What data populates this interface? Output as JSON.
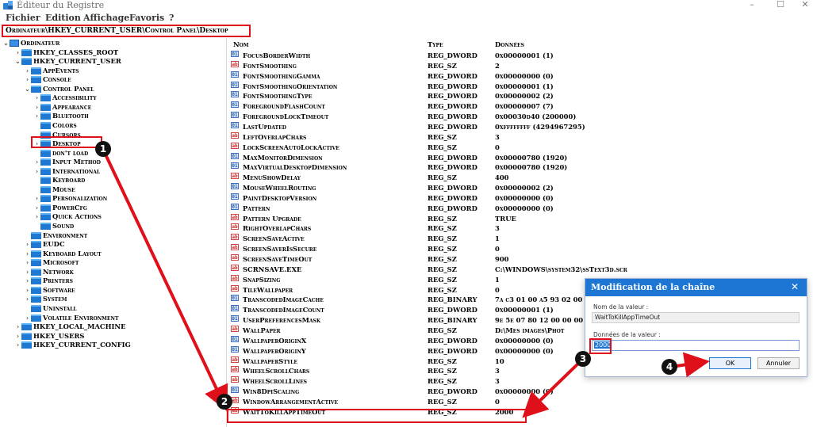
{
  "window": {
    "title": "Éditeur du Registre",
    "min_glyph": "–",
    "max_glyph": "☐",
    "close_glyph": "✕"
  },
  "menu": [
    "Fichier",
    "Edition",
    "Affichage",
    "Favoris",
    "?"
  ],
  "address": "Ordinateur\\HKEY_CURRENT_USER\\Control Panel\\Desktop",
  "tree": [
    {
      "label": "Ordinateur",
      "level": 0,
      "chev": "⌄",
      "icon": "computer"
    },
    {
      "label": "HKEY_CLASSES_ROOT",
      "level": 1,
      "chev": "›",
      "icon": "folder"
    },
    {
      "label": "HKEY_CURRENT_USER",
      "level": 1,
      "chev": "⌄",
      "icon": "folder"
    },
    {
      "label": "AppEvents",
      "level": 2,
      "chev": "›",
      "icon": "folder"
    },
    {
      "label": "Console",
      "level": 2,
      "chev": "›",
      "icon": "folder"
    },
    {
      "label": "Control Panel",
      "level": 2,
      "chev": "⌄",
      "icon": "folder"
    },
    {
      "label": "Accessibility",
      "level": 3,
      "chev": "›",
      "icon": "folder"
    },
    {
      "label": "Appearance",
      "level": 3,
      "chev": "›",
      "icon": "folder"
    },
    {
      "label": "Bluetooth",
      "level": 3,
      "chev": "›",
      "icon": "folder"
    },
    {
      "label": "Colors",
      "level": 3,
      "chev": "",
      "icon": "folder"
    },
    {
      "label": "Cursors",
      "level": 3,
      "chev": "",
      "icon": "folder"
    },
    {
      "label": "Desktop",
      "level": 3,
      "chev": "›",
      "icon": "folder"
    },
    {
      "label": "don't load",
      "level": 3,
      "chev": "",
      "icon": "folder"
    },
    {
      "label": "Input Method",
      "level": 3,
      "chev": "›",
      "icon": "folder"
    },
    {
      "label": "International",
      "level": 3,
      "chev": "›",
      "icon": "folder"
    },
    {
      "label": "Keyboard",
      "level": 3,
      "chev": "",
      "icon": "folder"
    },
    {
      "label": "Mouse",
      "level": 3,
      "chev": "",
      "icon": "folder"
    },
    {
      "label": "Personalization",
      "level": 3,
      "chev": "›",
      "icon": "folder"
    },
    {
      "label": "PowerCfg",
      "level": 3,
      "chev": "›",
      "icon": "folder"
    },
    {
      "label": "Quick Actions",
      "level": 3,
      "chev": "›",
      "icon": "folder"
    },
    {
      "label": "Sound",
      "level": 3,
      "chev": "",
      "icon": "folder"
    },
    {
      "label": "Environment",
      "level": 2,
      "chev": "",
      "icon": "folder"
    },
    {
      "label": "EUDC",
      "level": 2,
      "chev": "›",
      "icon": "folder"
    },
    {
      "label": "Keyboard Layout",
      "level": 2,
      "chev": "›",
      "icon": "folder"
    },
    {
      "label": "Microsoft",
      "level": 2,
      "chev": "›",
      "icon": "folder"
    },
    {
      "label": "Network",
      "level": 2,
      "chev": "›",
      "icon": "folder"
    },
    {
      "label": "Printers",
      "level": 2,
      "chev": "›",
      "icon": "folder"
    },
    {
      "label": "Software",
      "level": 2,
      "chev": "›",
      "icon": "folder"
    },
    {
      "label": "System",
      "level": 2,
      "chev": "›",
      "icon": "folder"
    },
    {
      "label": "Uninstall",
      "level": 2,
      "chev": "",
      "icon": "folder"
    },
    {
      "label": "Volatile Environment",
      "level": 2,
      "chev": "›",
      "icon": "folder"
    },
    {
      "label": "HKEY_LOCAL_MACHINE",
      "level": 1,
      "chev": "›",
      "icon": "folder"
    },
    {
      "label": "HKEY_USERS",
      "level": 1,
      "chev": "›",
      "icon": "folder"
    },
    {
      "label": "HKEY_CURRENT_CONFIG",
      "level": 1,
      "chev": "›",
      "icon": "folder"
    }
  ],
  "list": {
    "headers": {
      "name": "Nom",
      "type": "Type",
      "data": "Données"
    },
    "rows": [
      {
        "name": "FocusBorderWidth",
        "type": "REG_DWORD",
        "data": "0x00000001 (1)"
      },
      {
        "name": "FontSmoothing",
        "type": "REG_SZ",
        "data": "2"
      },
      {
        "name": "FontSmoothingGamma",
        "type": "REG_DWORD",
        "data": "0x00000000 (0)"
      },
      {
        "name": "FontSmoothingOrientation",
        "type": "REG_DWORD",
        "data": "0x00000001 (1)"
      },
      {
        "name": "FontSmoothingType",
        "type": "REG_DWORD",
        "data": "0x00000002 (2)"
      },
      {
        "name": "ForegroundFlashCount",
        "type": "REG_DWORD",
        "data": "0x00000007 (7)"
      },
      {
        "name": "ForegroundLockTimeout",
        "type": "REG_DWORD",
        "data": "0x00030d40 (200000)"
      },
      {
        "name": "LastUpdated",
        "type": "REG_DWORD",
        "data": "0xffffffff (4294967295)"
      },
      {
        "name": "LeftOverlapChars",
        "type": "REG_SZ",
        "data": "3"
      },
      {
        "name": "LockScreenAutoLockActive",
        "type": "REG_SZ",
        "data": "0"
      },
      {
        "name": "MaxMonitorDimension",
        "type": "REG_DWORD",
        "data": "0x00000780 (1920)"
      },
      {
        "name": "MaxVirtualDesktopDimension",
        "type": "REG_DWORD",
        "data": "0x00000780 (1920)"
      },
      {
        "name": "MenuShowDelay",
        "type": "REG_SZ",
        "data": "400"
      },
      {
        "name": "MouseWheelRouting",
        "type": "REG_DWORD",
        "data": "0x00000002 (2)"
      },
      {
        "name": "PaintDesktopVersion",
        "type": "REG_DWORD",
        "data": "0x00000000 (0)"
      },
      {
        "name": "Pattern",
        "type": "REG_DWORD",
        "data": "0x00000000 (0)"
      },
      {
        "name": "Pattern Upgrade",
        "type": "REG_SZ",
        "data": "TRUE"
      },
      {
        "name": "RightOverlapChars",
        "type": "REG_SZ",
        "data": "3"
      },
      {
        "name": "ScreenSaveActive",
        "type": "REG_SZ",
        "data": "1"
      },
      {
        "name": "ScreenSaverIsSecure",
        "type": "REG_SZ",
        "data": "0"
      },
      {
        "name": "ScreenSaveTimeOut",
        "type": "REG_SZ",
        "data": "900"
      },
      {
        "name": "SCRNSAVE.EXE",
        "type": "REG_SZ",
        "data": "C:\\WINDOWS\\system32\\ssText3d.scr"
      },
      {
        "name": "SnapSizing",
        "type": "REG_SZ",
        "data": "1"
      },
      {
        "name": "TileWallpaper",
        "type": "REG_SZ",
        "data": "0"
      },
      {
        "name": "TranscodedImageCache",
        "type": "REG_BINARY",
        "data": "7a c3 01 00 a5 93 02 00"
      },
      {
        "name": "TranscodedImageCount",
        "type": "REG_DWORD",
        "data": "0x00000001 (1)"
      },
      {
        "name": "UserPreferencesMask",
        "type": "REG_BINARY",
        "data": "9e 5e 07 80 12 00 00 00"
      },
      {
        "name": "WallPaper",
        "type": "REG_SZ",
        "data": "D:\\Mes images\\Phot"
      },
      {
        "name": "WallpaperOriginX",
        "type": "REG_DWORD",
        "data": "0x00000000 (0)"
      },
      {
        "name": "WallpaperOriginY",
        "type": "REG_DWORD",
        "data": "0x00000000 (0)"
      },
      {
        "name": "WallpaperStyle",
        "type": "REG_SZ",
        "data": "10"
      },
      {
        "name": "WheelScrollChars",
        "type": "REG_SZ",
        "data": "3"
      },
      {
        "name": "WheelScrollLines",
        "type": "REG_SZ",
        "data": "3"
      },
      {
        "name": "Win8DpiScaling",
        "type": "REG_DWORD",
        "data": "0x00000000 (0)"
      },
      {
        "name": "WindowArrangementActive",
        "type": "REG_SZ",
        "data": "0"
      },
      {
        "name": "WaitToKillAppTimeOut",
        "type": "REG_SZ",
        "data": "2000"
      }
    ]
  },
  "dialog": {
    "title": "Modification de la chaîne",
    "close_glyph": "✕",
    "name_label": "Nom de la valeur :",
    "name_value": "WaitToKillAppTimeOut",
    "data_label": "Données de la valeur :",
    "data_value": "2000",
    "ok_label": "OK",
    "cancel_label": "Annuler"
  },
  "annotations": [
    "1",
    "2",
    "3",
    "4"
  ],
  "colors": {
    "highlight": "#e0101a",
    "accent": "#1d76d3",
    "folder": "#1f78d1"
  }
}
